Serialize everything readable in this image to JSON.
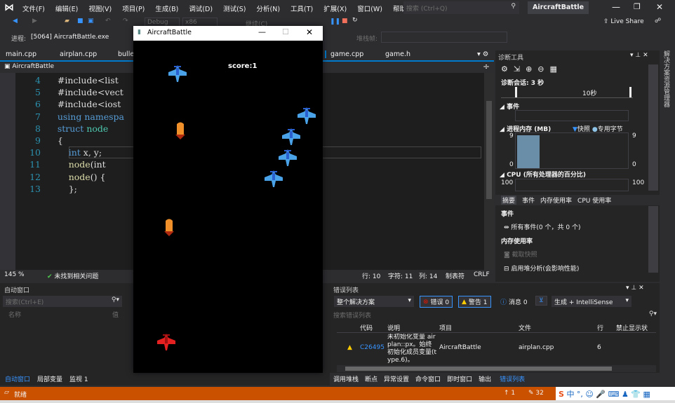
{
  "menu": {
    "items": [
      "文件(F)",
      "编辑(E)",
      "视图(V)",
      "项目(P)",
      "生成(B)",
      "调试(D)",
      "测试(S)",
      "分析(N)",
      "工具(T)",
      "扩展(X)",
      "窗口(W)",
      "帮助(H)"
    ],
    "search_placeholder": "搜索 (Ctrl+Q)",
    "window_title": "AircraftBattle"
  },
  "toolbar": {
    "config": "Debug",
    "platform": "x86",
    "continue": "继续(C)",
    "live_share": "Live Share",
    "process_label": "进程:",
    "process_value": "[5064] AircraftBattle.exe",
    "stackframe_label": "堆栈帧:"
  },
  "tabs": [
    "main.cpp",
    "airplan.cpp",
    "bulle",
    "game.cpp",
    "game.h"
  ],
  "nav": {
    "project": "AircraftBattle"
  },
  "code": {
    "lines": [
      {
        "n": "4",
        "t": "#include<list"
      },
      {
        "n": "5",
        "t": "#include<vect"
      },
      {
        "n": "6",
        "t": "#include<iost"
      },
      {
        "n": "7",
        "kw": "using namespa"
      },
      {
        "n": "8",
        "kw": "struct",
        "ty": "node"
      },
      {
        "n": "9",
        "t": "{"
      },
      {
        "n": "10",
        "kw": "int",
        "t": "x, y;"
      },
      {
        "n": "11",
        "fn": "node",
        "t": "(int"
      },
      {
        "n": "12",
        "fn": "node",
        "t": "() {"
      },
      {
        "n": "13",
        "t": "};"
      }
    ]
  },
  "editor_status": {
    "zoom": "145 %",
    "issues": "未找到相关问题",
    "line": "行: 10",
    "char": "字符: 11",
    "col": "列: 14",
    "tabs": "制表符",
    "eol": "CRLF"
  },
  "game": {
    "title": "AircraftBattle",
    "score": "score:1"
  },
  "diag": {
    "title": "诊断工具",
    "session": "诊断会话: 3 秒",
    "timeline_label": "10秒",
    "events": "事件",
    "memory": "进程内存 (MB)",
    "snapshot": "快照",
    "private_bytes": "专用字节",
    "mem_max": "9",
    "mem_min": "0",
    "cpu": "CPU (所有处理器的百分比)",
    "cpu_max": "100",
    "tabs": [
      "摘要",
      "事件",
      "内存使用率",
      "CPU 使用率"
    ],
    "sec_events": "事件",
    "all_events": "所有事件(0 个，共 0 个)",
    "sec_memory": "内存使用率",
    "take_snapshot": "截取快照",
    "heap": "启用堆分析(会影响性能)",
    "memory_fill": 0.95
  },
  "solution_explorer": "解决方案资源管理器",
  "autos": {
    "title": "自动窗口",
    "search_placeholder": "搜索(Ctrl+E)",
    "col_name": "名称",
    "col_value": "值",
    "tabs": [
      "自动窗口",
      "局部变量",
      "监视 1"
    ]
  },
  "errors": {
    "title": "错误列表",
    "scope": "整个解决方案",
    "err": "错误 0",
    "warn": "警告 1",
    "msg": "消息 0",
    "source": "生成 + IntelliSense",
    "search_placeholder": "搜索错误列表",
    "cols": [
      "代码",
      "说明",
      "项目",
      "文件",
      "行",
      "禁止显示状"
    ],
    "rows": [
      {
        "code": "C26495",
        "desc": "未初始化变量 airplan::px。始终初始化成员变量(type.6)。",
        "project": "AircraftBattle",
        "file": "airplan.cpp",
        "line": "6"
      }
    ],
    "tabs": [
      "调用堆栈",
      "断点",
      "异常设置",
      "命令窗口",
      "即时窗口",
      "输出",
      "错误列表"
    ]
  },
  "status": {
    "ready": "就绪",
    "up": "1",
    "edits": "32",
    "ime": "中"
  },
  "colors": {
    "accent": "#007acc",
    "status": "#ca5100",
    "bg": "#1e1e1e"
  }
}
